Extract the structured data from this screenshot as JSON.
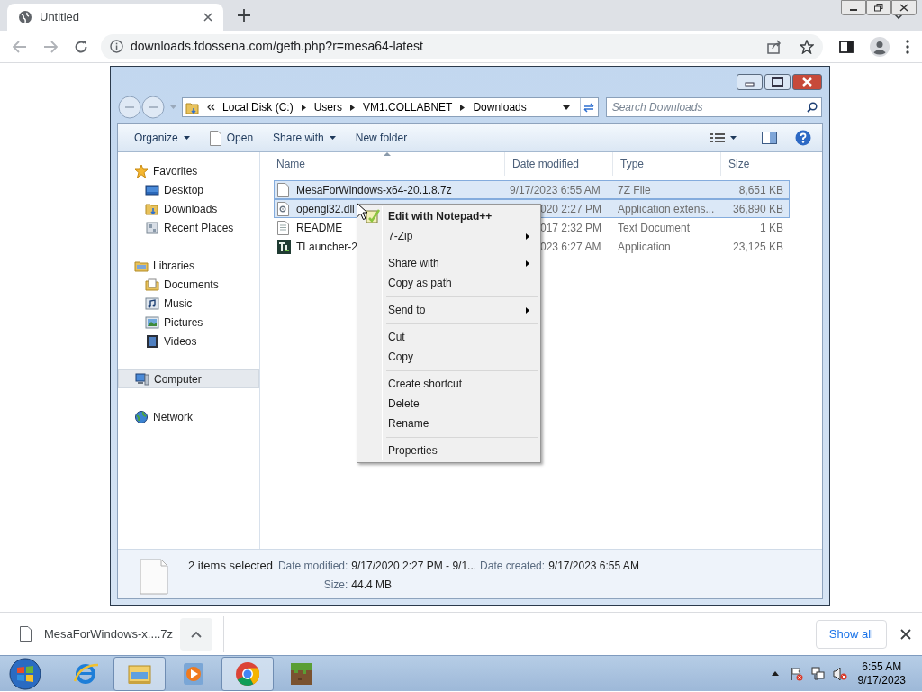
{
  "browser": {
    "tab": {
      "title": "Untitled",
      "selected": true
    },
    "url": "downloads.fdossena.com/geth.php?r=mesa64-latest"
  },
  "explorer": {
    "breadcrumb": [
      "Local Disk (C:)",
      "Users",
      "VM1.COLLABNET",
      "Downloads"
    ],
    "search": {
      "placeholder": "Search Downloads"
    },
    "toolbar": [
      {
        "label": "Organize",
        "kind": "menu"
      },
      {
        "label": "Open",
        "kind": "open"
      },
      {
        "label": "Share with",
        "kind": "menu"
      },
      {
        "label": "New folder",
        "kind": "plain"
      }
    ],
    "sidebar": [
      {
        "label": "Favorites",
        "kind": "star",
        "selected": false,
        "children": [
          {
            "label": "Desktop",
            "kind": "desktop",
            "selected": false
          },
          {
            "label": "Downloads",
            "kind": "downloads",
            "selected": false
          },
          {
            "label": "Recent Places",
            "kind": "recent",
            "selected": false
          }
        ]
      },
      {
        "label": "Libraries",
        "kind": "library",
        "selected": false,
        "children": [
          {
            "label": "Documents",
            "kind": "documents",
            "selected": false
          },
          {
            "label": "Music",
            "kind": "music",
            "selected": false
          },
          {
            "label": "Pictures",
            "kind": "pictures",
            "selected": false
          },
          {
            "label": "Videos",
            "kind": "videos",
            "selected": false
          }
        ]
      },
      {
        "label": "Computer",
        "kind": "computer",
        "selected": true
      },
      {
        "label": "Network",
        "kind": "network",
        "selected": false
      }
    ],
    "columns": [
      "Name",
      "Date modified",
      "Type",
      "Size"
    ],
    "rows": [
      {
        "kind": "archive",
        "name": "MesaForWindows-x64-20.1.8.7z",
        "date": "9/17/2023 6:55 AM",
        "type": "7Z File",
        "size": "8,651 KB",
        "selected": true,
        "covered": false
      },
      {
        "kind": "dll",
        "name": "opengl32.dll",
        "date": "020 2:27 PM",
        "type": "Application extens...",
        "size": "36,890 KB",
        "selected": true,
        "covered": true
      },
      {
        "kind": "text",
        "name": "README",
        "date": "017 2:32 PM",
        "type": "Text Document",
        "size": "1 KB",
        "selected": false,
        "covered": true
      },
      {
        "kind": "app",
        "name": "TLauncher-2",
        "date": "023 6:27 AM",
        "type": "Application",
        "size": "23,125 KB",
        "selected": false,
        "covered": true
      }
    ],
    "details": {
      "title": "2 items selected",
      "fields": [
        {
          "label": "Date modified:",
          "value": "9/17/2020 2:27 PM - 9/1..."
        },
        {
          "label": "Date created:",
          "value": "9/17/2023 6:55 AM"
        },
        {
          "label": "Size:",
          "value": "44.4 MB"
        }
      ]
    }
  },
  "context_menu": [
    {
      "kind": "default",
      "label": "Edit with Notepad++"
    },
    {
      "kind": "submenu",
      "label": "7-Zip"
    },
    {
      "kind": "separator"
    },
    {
      "kind": "submenu",
      "label": "Share with"
    },
    {
      "kind": "item",
      "label": "Copy as path"
    },
    {
      "kind": "separator"
    },
    {
      "kind": "submenu",
      "label": "Send to"
    },
    {
      "kind": "separator"
    },
    {
      "kind": "item",
      "label": "Cut"
    },
    {
      "kind": "item",
      "label": "Copy"
    },
    {
      "kind": "separator"
    },
    {
      "kind": "item",
      "label": "Create shortcut"
    },
    {
      "kind": "item",
      "label": "Delete"
    },
    {
      "kind": "item",
      "label": "Rename"
    },
    {
      "kind": "separator"
    },
    {
      "kind": "item",
      "label": "Properties"
    }
  ],
  "downloads_bar": {
    "file": "MesaForWindows-x....7z",
    "show_all": "Show all"
  },
  "taskbar": {
    "apps": [
      {
        "kind": "ie",
        "active": false
      },
      {
        "kind": "explorer",
        "active": true
      },
      {
        "kind": "media",
        "active": false
      },
      {
        "kind": "chrome",
        "active": true
      },
      {
        "kind": "minecraft",
        "active": false
      }
    ],
    "clock": {
      "time": "6:55 AM",
      "date": "9/17/2023"
    }
  }
}
